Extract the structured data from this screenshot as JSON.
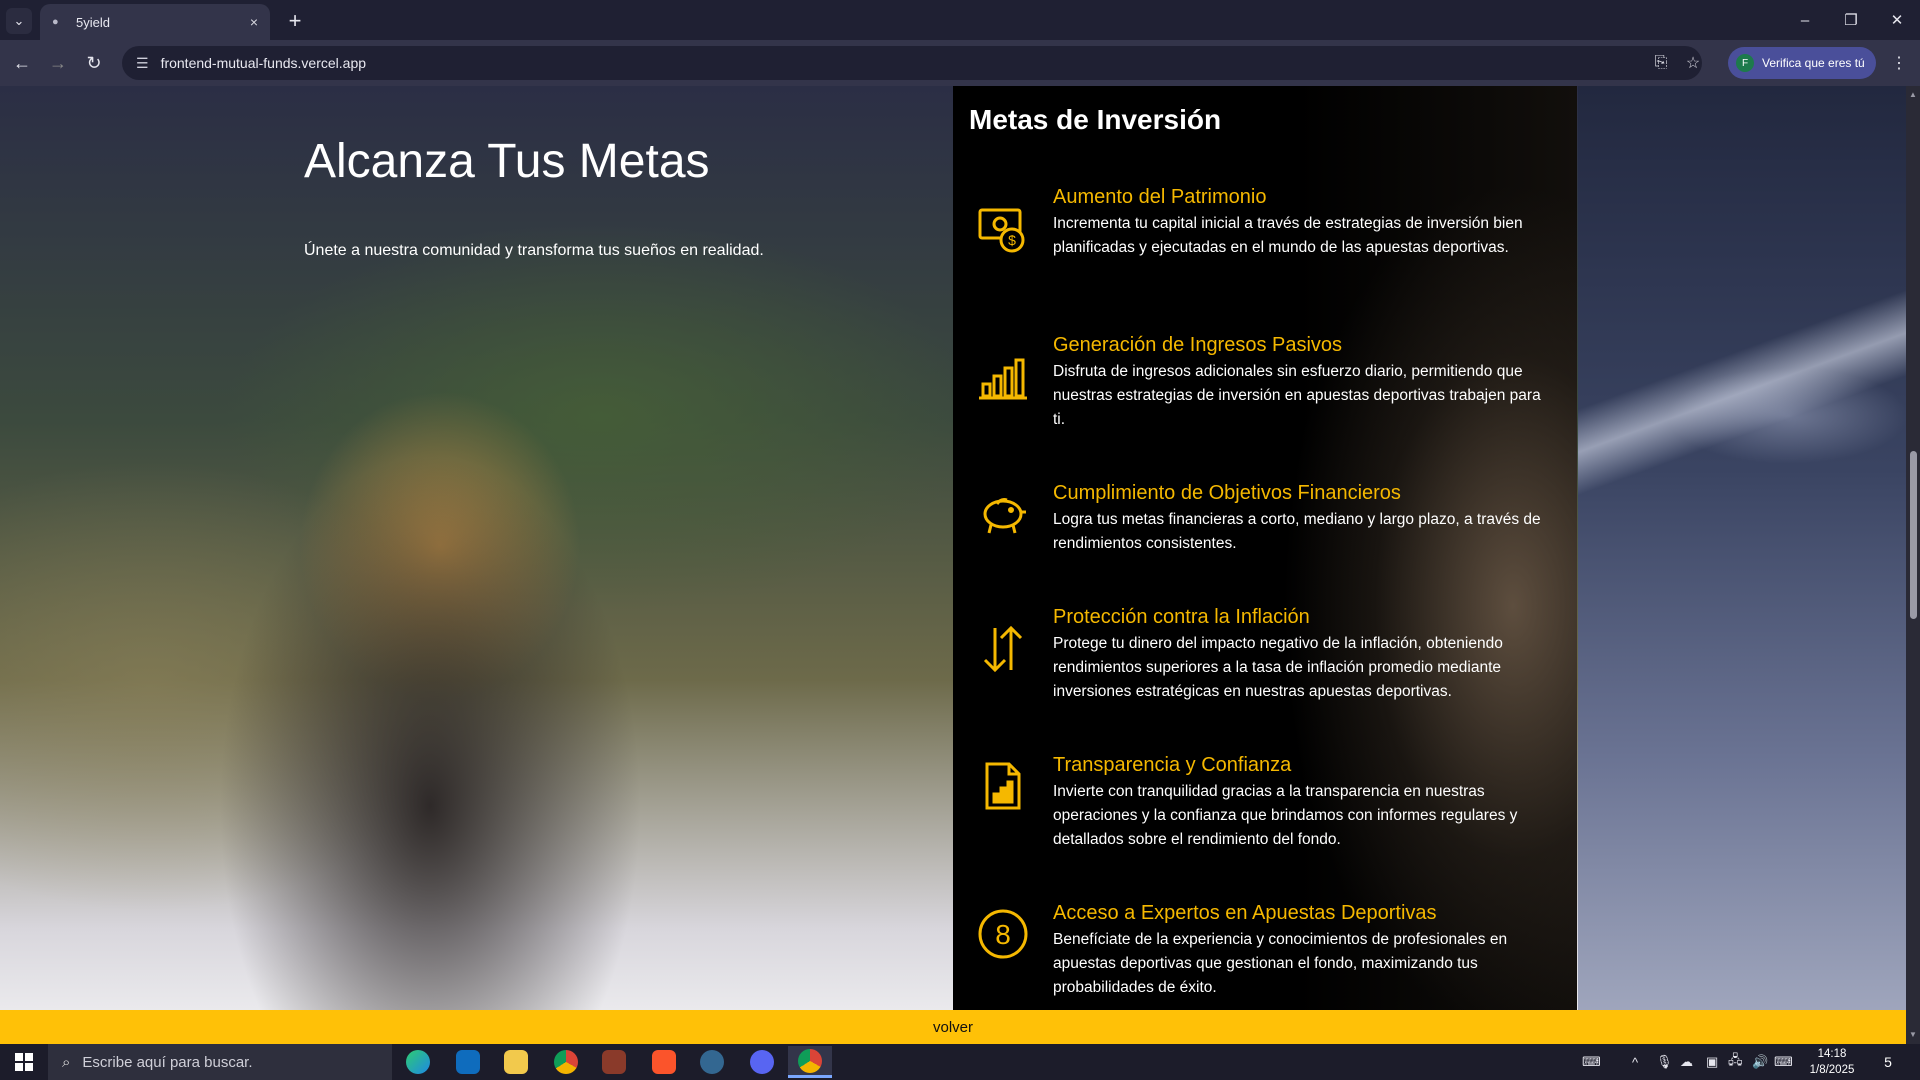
{
  "browser": {
    "tab_title": "5yield",
    "tab_close": "×",
    "new_tab": "+",
    "url": "frontend-mutual-funds.vercel.app",
    "profile_initial": "F",
    "profile_label": "Verifica que eres tú",
    "window_controls": {
      "minimize": "–",
      "restore": "❐",
      "close": "✕"
    }
  },
  "hero": {
    "title": "Alcanza Tus Metas",
    "subtitle": "Únete a nuestra comunidad y transforma tus sueños en realidad."
  },
  "goals": {
    "title": "Metas de Inversión",
    "items": [
      {
        "icon": "money-icon",
        "title": "Aumento del Patrimonio",
        "description": "Incrementa tu capital inicial a través de estrategias de inversión bien planificadas y ejecutadas en el mundo de las apuestas deportivas."
      },
      {
        "icon": "bar-chart-icon",
        "title": "Generación de Ingresos Pasivos",
        "description": "Disfruta de ingresos adicionales sin esfuerzo diario, permitiendo que nuestras estrategias de inversión en apuestas deportivas trabajen para ti."
      },
      {
        "icon": "piggy-bank-icon",
        "title": "Cumplimiento de Objetivos Financieros",
        "description": "Logra tus metas financieras a corto, mediano y largo plazo, a través de rendimientos consistentes."
      },
      {
        "icon": "arrows-up-down-icon",
        "title": "Protección contra la Inflación",
        "description": "Protege tu dinero del impacto negativo de la inflación, obteniendo rendimientos superiores a la tasa de inflación promedio mediante inversiones estratégicas en nuestras apuestas deportivas."
      },
      {
        "icon": "report-icon",
        "title": "Transparencia y Confianza",
        "description": "Invierte con tranquilidad gracias a la transparencia en nuestras operaciones y la confianza que brindamos con informes regulares y detallados sobre el rendimiento del fondo."
      },
      {
        "icon": "number-eight-icon",
        "title": "Acceso a Expertos en Apuestas Deportivas",
        "description": "Benefíciate de la experiencia y conocimientos de profesionales en apuestas deportivas que gestionan el fondo, maximizando tus probabilidades de éxito."
      }
    ]
  },
  "footer": {
    "volver_label": "volver"
  },
  "taskbar": {
    "search_placeholder": "Escribe aquí para buscar.",
    "time": "14:18",
    "date": "1/8/2025",
    "notification_count": "5",
    "apps": [
      "edge",
      "outlook",
      "file-explorer",
      "chrome",
      "game",
      "brave",
      "postgres",
      "discord",
      "chrome-profile"
    ]
  },
  "colors": {
    "accent": "#ffc107",
    "goal_title": "#f5b800",
    "panel": "#000000"
  }
}
